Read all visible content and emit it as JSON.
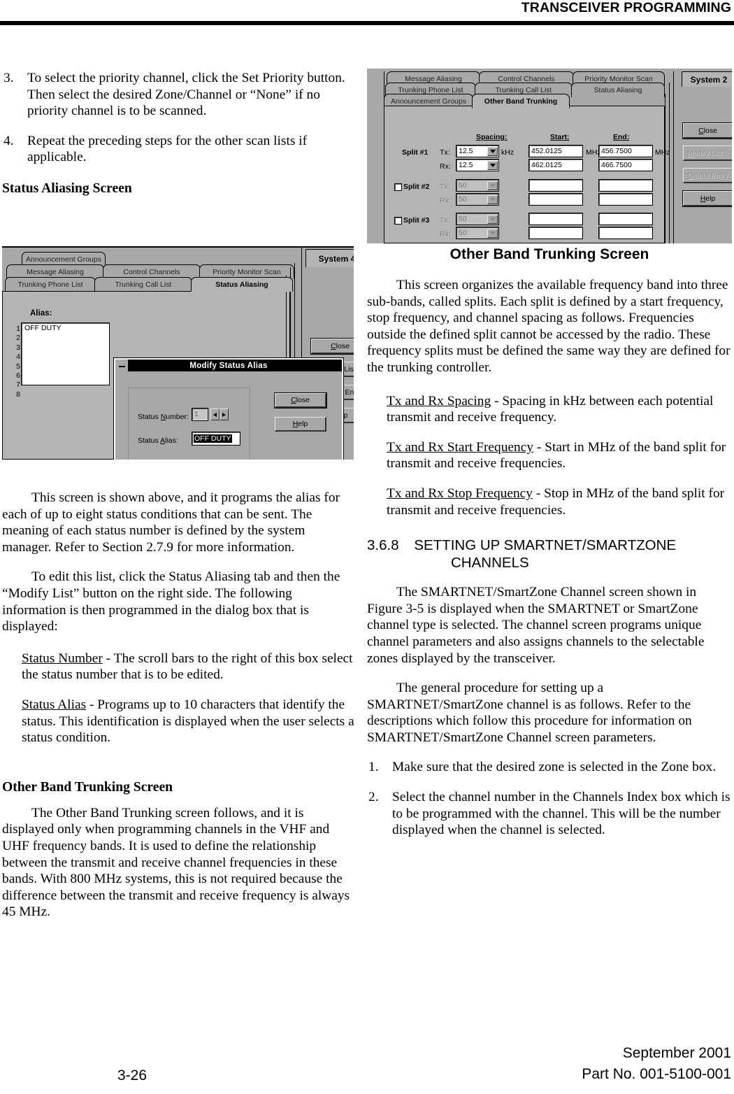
{
  "header": {
    "title": "TRANSCEIVER PROGRAMMING"
  },
  "footer": {
    "page": "3-26",
    "date": "September 2001",
    "part": "Part No. 001-5100-001"
  },
  "left_column": {
    "step3": {
      "num": "3.",
      "text": "To select the priority channel, click the Set Priority button. Then select the desired Zone/Channel or “None” if no priority channel is to be scanned."
    },
    "step4": {
      "num": "4.",
      "text": "Repeat the preceding steps for the other scan lists if applicable."
    },
    "heading_status_aliasing": "Status Aliasing Screen",
    "para1": "This screen is shown above, and it programs the alias for each of up to eight status conditions that can be sent. The meaning of each status number is defined by the system manager. Refer to Section 2.7.9 for more information.",
    "para2": "To edit this list, click the Status Aliasing tab and then the “Modify List” button on the right side. The following information is then programmed in the dialog box that is displayed:",
    "def_status_number": {
      "term": "Status Number",
      "text": " - The scroll bars to the right of this box select the status number that is to be edited."
    },
    "def_status_alias": {
      "term": "Status Alias",
      "text": " - Programs up to 10 characters that identify the status. This identification is displayed when the user selects a status condition."
    },
    "heading_other_band": "Other Band Trunking Screen",
    "para3": "The Other Band Trunking screen follows, and it is displayed only when programming channels in the VHF and UHF frequency bands. It is used to define the relationship between the transmit and receive channel frequencies in these bands. With 800 MHz systems, this is not required because the difference between the transmit and receive frequency is always 45 MHz."
  },
  "right_column": {
    "figure_caption": "Other Band Trunking Screen",
    "para1": "This screen organizes the available frequency band into three sub-bands, called splits. Each split is defined by a start frequency, stop frequency, and channel spacing as follows. Frequencies outside the defined split cannot be accessed by the radio. These frequency splits must be defined the same way they are defined for the trunking controller.",
    "def_spacing": {
      "term": "Tx and Rx Spacing",
      "text": " - Spacing in kHz between each potential transmit and receive frequency."
    },
    "def_start": {
      "term": "Tx and Rx Start Frequency",
      "text": " - Start in MHz of the band split for transmit and receive frequencies."
    },
    "def_stop": {
      "term": "Tx and Rx Stop Frequency",
      "text": " - Stop in MHz of the band split for transmit and receive frequencies."
    },
    "section_number": "3.6.8",
    "section_title_line1": "SETTING UP SMARTNET/SMARTZONE",
    "section_title_line2": "CHANNELS",
    "para2": "The SMARTNET/SmartZone Channel screen shown in Figure 3-5 is displayed when the SMARTNET or SmartZone channel type is selected. The channel screen programs unique channel parameters and also assigns channels to the selectable zones displayed by the transceiver.",
    "para3": "The general procedure for setting up a SMARTNET/SmartZone channel is as follows. Refer to the descriptions which follow this procedure for information on SMARTNET/SmartZone Channel screen parameters.",
    "step1": {
      "num": "1.",
      "text": "Make sure that the desired zone is selected in the Zone box."
    },
    "step2": {
      "num": "2.",
      "text": "Select the channel number in the Channels Index box which is to be programmed with the channel. This will be the number displayed when the channel is selected."
    }
  },
  "screenshot_status_aliasing": {
    "tabs_row1": [
      "Announcement Groups"
    ],
    "tabs_row2": [
      "Message Aliasing",
      "Control Channels",
      "Priority Monitor Scan"
    ],
    "tabs_row3": [
      "Trunking Phone List",
      "Trunking Call List",
      "Status Aliasing"
    ],
    "active_tab": "Status Aliasing",
    "system_label": "System 4",
    "alias_label": "Alias:",
    "alias_rows": [
      "1",
      "2",
      "3",
      "4",
      "5",
      "6",
      "7",
      "8"
    ],
    "alias_values": [
      "OFF DUTY",
      "",
      "",
      "",
      "",
      "",
      "",
      ""
    ],
    "buttons": [
      {
        "label": "Close",
        "accel": "C",
        "enabled": true
      },
      {
        "label": "Modify List ...",
        "accel": "M",
        "enabled": true
      },
      {
        "label": "Delete Entry",
        "accel": "D",
        "enabled": true
      },
      {
        "label": "Help",
        "accel": "H",
        "enabled": true
      }
    ],
    "dialog": {
      "title": "Modify Status Alias",
      "status_number_label": "Status Number:",
      "status_number_value": "1",
      "status_alias_label": "Status Alias:",
      "status_alias_value": "OFF DUTY",
      "buttons": [
        {
          "label": "Close",
          "accel": "C"
        },
        {
          "label": "Help",
          "accel": "H"
        }
      ]
    }
  },
  "screenshot_other_band": {
    "tabs_row1": [
      "Message Aliasing",
      "Control Channels",
      "Priority Monitor Scan"
    ],
    "tabs_row2": [
      "Trunking Phone List",
      "Trunking Call List",
      "Status Aliasing"
    ],
    "tabs_row3": [
      "Announcement Groups",
      "Other Band Trunking"
    ],
    "active_tab": "Other Band Trunking",
    "system_label": "System 2",
    "col_headers": {
      "spacing": "Spacing:",
      "start": "Start:",
      "end": "End:"
    },
    "units": {
      "khz": "kHz",
      "mhz": "MHz"
    },
    "splits": [
      {
        "name": "Split #1",
        "enabled": true,
        "has_checkbox": false,
        "tx_label": "Tx:",
        "rx_label": "Rx:",
        "tx_spacing": "12.5",
        "rx_spacing": "12.5",
        "tx_start": "452.0125",
        "rx_start": "462.0125",
        "tx_end": "456.7500",
        "rx_end": "466.7500"
      },
      {
        "name": "Split #2",
        "enabled": false,
        "has_checkbox": true,
        "tx_label": "Tx:",
        "rx_label": "Rx:",
        "tx_spacing": "50",
        "rx_spacing": "50",
        "tx_start": "",
        "rx_start": "",
        "tx_end": "",
        "rx_end": ""
      },
      {
        "name": "Split #3",
        "enabled": false,
        "has_checkbox": true,
        "tx_label": "Tx:",
        "rx_label": "Rx:",
        "tx_spacing": "50",
        "rx_spacing": "50",
        "tx_start": "",
        "rx_start": "",
        "tx_end": "",
        "rx_end": ""
      }
    ],
    "buttons": [
      {
        "label": "Close",
        "accel": "C",
        "enabled": true
      },
      {
        "label": "Modify List...",
        "accel": "M",
        "enabled": false
      },
      {
        "label": "Delete Entry",
        "accel": "D",
        "enabled": false
      },
      {
        "label": "Help",
        "accel": "H",
        "enabled": true
      }
    ]
  }
}
